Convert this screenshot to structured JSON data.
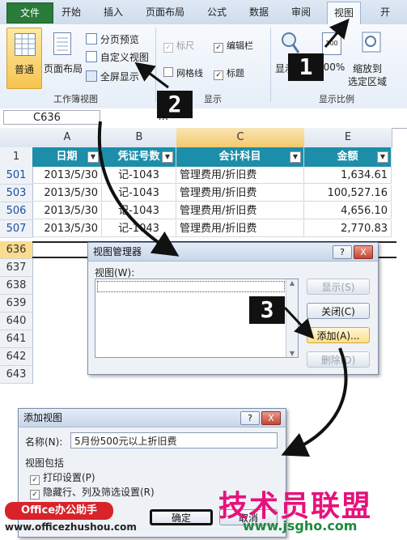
{
  "tabs": [
    "文件",
    "开始",
    "插入",
    "页面布局",
    "公式",
    "数据",
    "审阅",
    "视图",
    "开"
  ],
  "ribbon": {
    "workbook_views": {
      "normal": "普通",
      "page_layout": "页面布局",
      "page_break": "分页预览",
      "custom_views": "自定义视图",
      "full_screen": "全屏显示",
      "group_label": "工作簿视图"
    },
    "show": {
      "ruler": "标尺",
      "formula_bar": "编辑栏",
      "gridlines": "网格线",
      "headings": "标题",
      "group_label": "显示"
    },
    "zoom": {
      "zoom": "显示",
      "hundred": "100%",
      "zoom_to_selection": "缩放到",
      "zoom_to_selection_2": "选定区域",
      "group_label": "显示比例"
    }
  },
  "formula_bar": {
    "name_box": "C636",
    "fx": "fx"
  },
  "columns": [
    "A",
    "B",
    "C",
    "E"
  ],
  "header_row": {
    "num": "1",
    "cells": [
      "日期",
      "凭证号数",
      "会计科目",
      "金额"
    ]
  },
  "rows": [
    {
      "num": "501",
      "date": "2013/5/30",
      "voucher": "记-1043",
      "account": "管理费用/折旧费",
      "amount": "1,634.61"
    },
    {
      "num": "503",
      "date": "2013/5/30",
      "voucher": "记-1043",
      "account": "管理费用/折旧费",
      "amount": "100,527.16"
    },
    {
      "num": "506",
      "date": "2013/5/30",
      "voucher": "记-1043",
      "account": "管理费用/折旧费",
      "amount": "4,656.10"
    },
    {
      "num": "507",
      "date": "2013/5/30",
      "voucher": "记-1043",
      "account": "管理费用/折旧费",
      "amount": "2,770.83"
    }
  ],
  "empty_rows": [
    "636",
    "637",
    "638",
    "639",
    "640",
    "641",
    "642",
    "643"
  ],
  "view_manager": {
    "title": "视图管理器",
    "help": "?",
    "close": "X",
    "views_label": "视图(W):",
    "show_btn": "显示(S)",
    "close_btn": "关闭(C)",
    "add_btn": "添加(A)...",
    "delete_btn": "删除(D)"
  },
  "add_view": {
    "title": "添加视图",
    "help": "?",
    "close": "X",
    "name_label": "名称(N):",
    "name_value": "5月份500元以上折旧费",
    "include_label": "视图包括",
    "print_settings": "打印设置(P)",
    "hidden_rows": "隐藏行、列及筛选设置(R)",
    "ok_btn": "确定",
    "cancel_btn": "取消"
  },
  "callouts": [
    "1",
    "2",
    "3"
  ],
  "watermarks": {
    "left_logo": "Office办公助手",
    "left_url": "www.officezhushou.com",
    "right_logo": "技术员联盟",
    "right_url": "www.jsgho.com"
  }
}
